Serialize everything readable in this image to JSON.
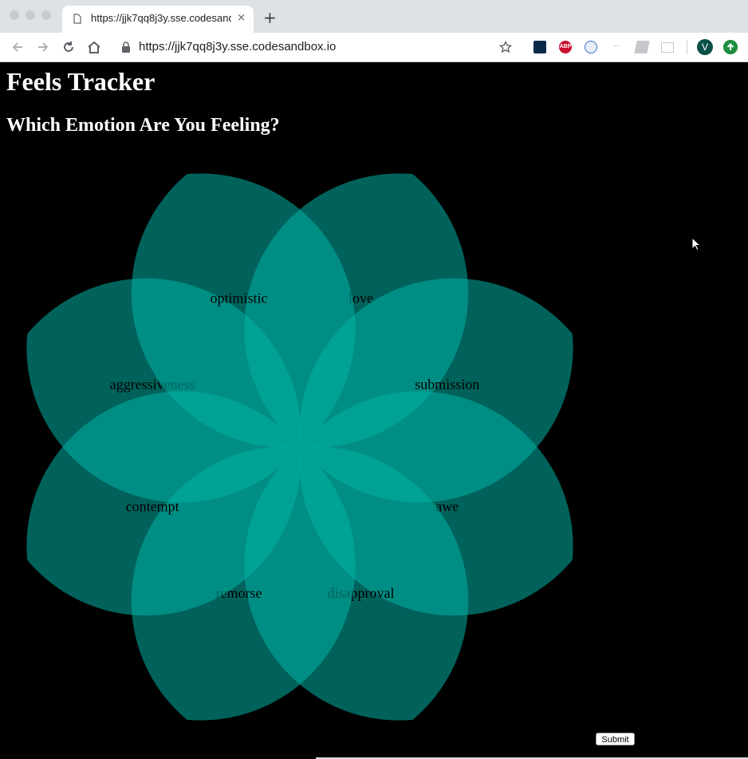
{
  "browser": {
    "tab_title": "https://jjk7qq8j3y.sse.codesandbox.io",
    "tab_close": "×",
    "new_tab": "+",
    "url": "https://jjk7qq8j3y.sse.codesandbox.io",
    "profile_initial": "V",
    "extensions": [
      "moon-extension-icon",
      "adblock-plus-icon",
      "phone-extension-icon",
      "dots-extension-icon",
      "book-extension-icon",
      "cast-icon"
    ]
  },
  "page": {
    "title": "Feels Tracker",
    "subtitle": "Which Emotion Are You Feeling?",
    "petal_color": "#00b3a6",
    "emotions": [
      "love",
      "submission",
      "awe",
      "disapproval",
      "remorse",
      "contempt",
      "aggressiveness",
      "optimistic"
    ],
    "submit_label": "Submit"
  }
}
